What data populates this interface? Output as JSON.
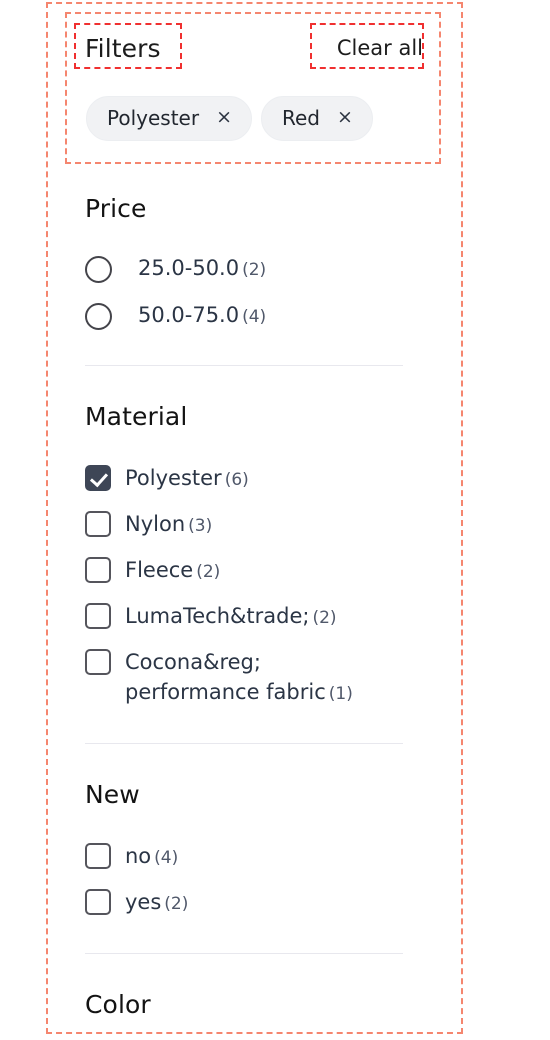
{
  "header": {
    "title": "Filters",
    "clear_all_label": "Clear all",
    "chips": [
      {
        "label": "Polyester",
        "remove_icon": "×"
      },
      {
        "label": "Red",
        "remove_icon": "×"
      }
    ]
  },
  "sections": [
    {
      "heading": "Price",
      "control": "radio",
      "options": [
        {
          "label": "25.0-50.0",
          "count": "(2)",
          "selected": false
        },
        {
          "label": "50.0-75.0",
          "count": "(4)",
          "selected": false
        }
      ]
    },
    {
      "heading": "Material",
      "control": "checkbox",
      "options": [
        {
          "label": "Polyester",
          "count": "(6)",
          "selected": true
        },
        {
          "label": "Nylon",
          "count": "(3)",
          "selected": false
        },
        {
          "label": "Fleece",
          "count": "(2)",
          "selected": false
        },
        {
          "label": "LumaTech&trade;",
          "count": "(2)",
          "selected": false
        },
        {
          "label": "Cocona&reg; performance fabric",
          "count": "(1)",
          "selected": false
        }
      ]
    },
    {
      "heading": "New",
      "control": "checkbox",
      "options": [
        {
          "label": "no",
          "count": "(4)",
          "selected": false
        },
        {
          "label": "yes",
          "count": "(2)",
          "selected": false
        }
      ]
    },
    {
      "heading": "Color",
      "control": "checkbox",
      "options": []
    }
  ],
  "colors": {
    "checked_box": "#3e4656",
    "chip_background": "#f1f2f4",
    "label_text": "#2b3545",
    "heading_text": "#131313",
    "divider": "#e8e8ee",
    "annotation_outer": "#f5866f",
    "annotation_inner": "#f03030"
  }
}
